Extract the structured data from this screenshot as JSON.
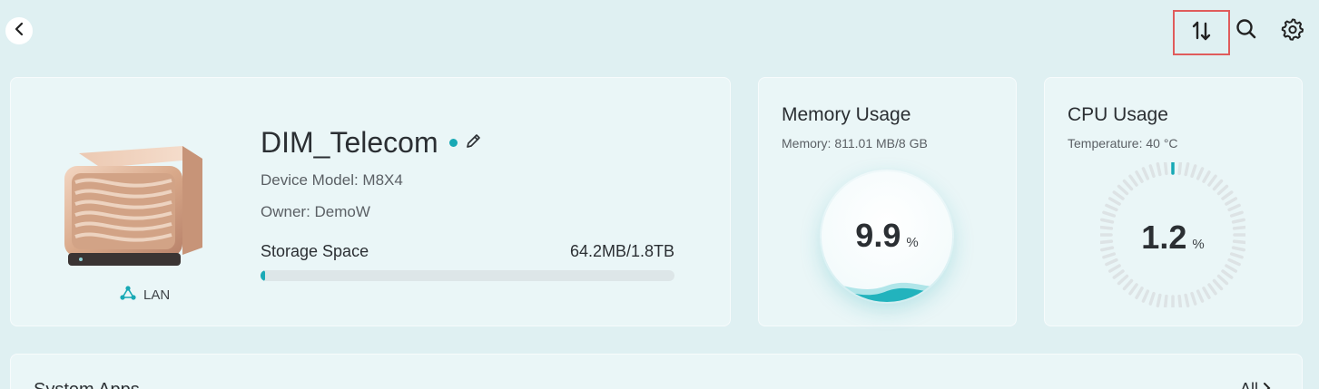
{
  "topbar": {
    "back_icon": "chevron-left-icon",
    "sort_icon": "sort-icon",
    "search_icon": "search-icon",
    "settings_icon": "gear-icon"
  },
  "device": {
    "name": "DIM_Telecom",
    "status_color": "#18a9b5",
    "model_line": "Device Model: M8X4",
    "owner_line": "Owner: DemoW",
    "storage_label": "Storage Space",
    "storage_value": "64.2MB/1.8TB",
    "storage_fraction": 0.01,
    "network_label": "LAN"
  },
  "memory": {
    "title": "Memory Usage",
    "subtitle": "Memory: 811.01 MB/8 GB",
    "value": "9.9",
    "unit": "%"
  },
  "cpu": {
    "title": "CPU Usage",
    "subtitle": "Temperature: 40 °C",
    "value": "1.2",
    "unit": "%",
    "fraction": 0.012
  },
  "apps": {
    "title": "System Apps",
    "all_label": "All"
  },
  "colors": {
    "accent": "#18a9b5",
    "highlight_border": "#e05c5c"
  }
}
